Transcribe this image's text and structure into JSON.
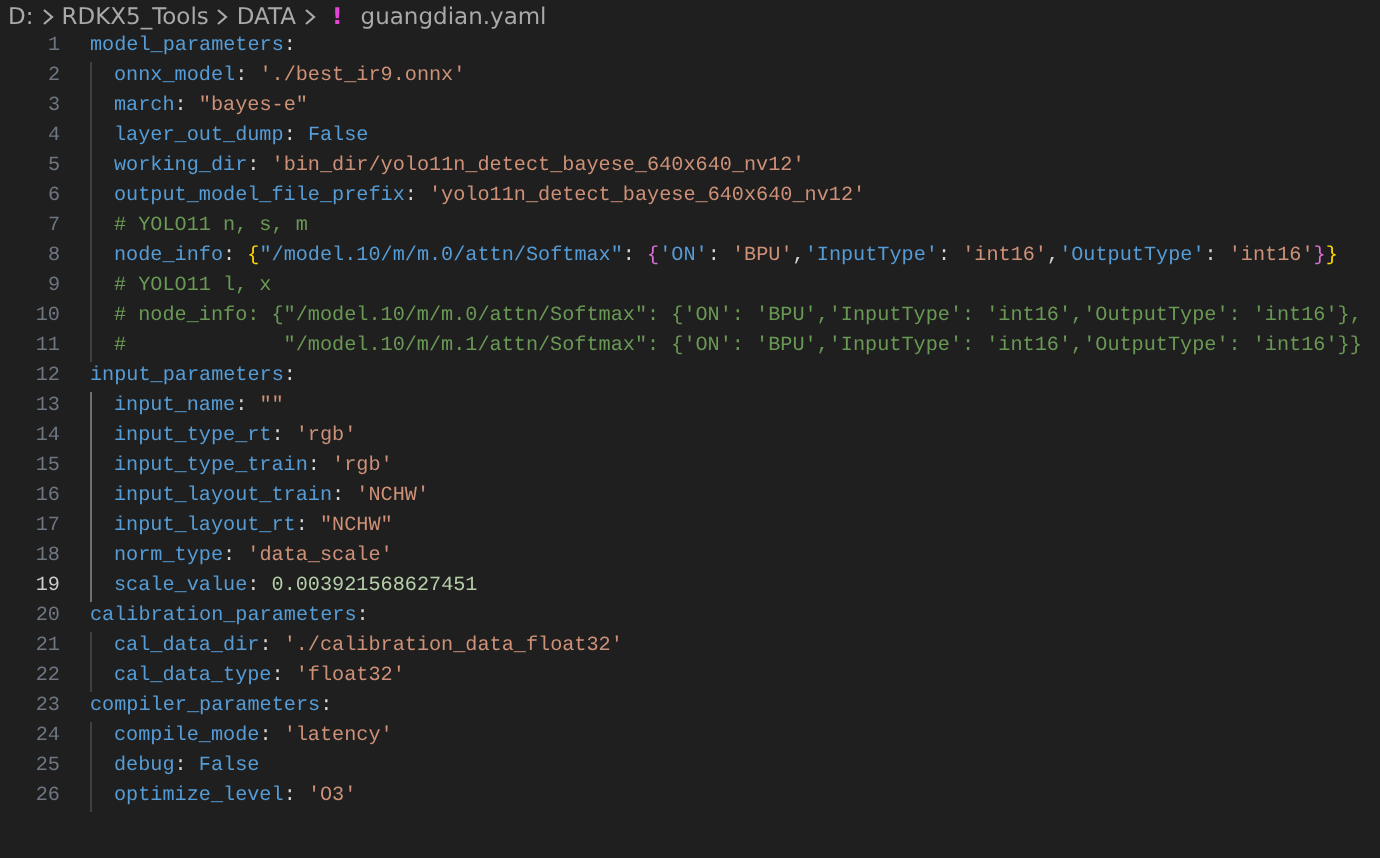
{
  "breadcrumb": {
    "items": [
      {
        "text": "D:",
        "kind": "folder"
      },
      {
        "text": "RDKX5_Tools",
        "kind": "folder"
      },
      {
        "text": "DATA",
        "kind": "folder"
      },
      {
        "text": "guangdian.yaml",
        "kind": "file",
        "icon": "!"
      }
    ]
  },
  "editor": {
    "lines": [
      {
        "number": "1",
        "current": false,
        "tokens": [
          {
            "kind": "key",
            "text": "model_parameters"
          },
          {
            "kind": "punct",
            "text": ":"
          }
        ],
        "children": [
          {
            "number": "2",
            "current": false,
            "tokens": [
              {
                "kind": "key",
                "text": "onnx_model"
              },
              {
                "kind": "punct",
                "text": ": "
              },
              {
                "kind": "string",
                "text": "'./best_ir9.onnx'"
              }
            ]
          },
          {
            "number": "3",
            "current": false,
            "tokens": [
              {
                "kind": "key",
                "text": "march"
              },
              {
                "kind": "punct",
                "text": ": "
              },
              {
                "kind": "string",
                "text": "\"bayes-e\""
              }
            ]
          },
          {
            "number": "4",
            "current": false,
            "tokens": [
              {
                "kind": "key",
                "text": "layer_out_dump"
              },
              {
                "kind": "punct",
                "text": ": "
              },
              {
                "kind": "keyword",
                "text": "False"
              }
            ]
          },
          {
            "number": "5",
            "current": false,
            "tokens": [
              {
                "kind": "key",
                "text": "working_dir"
              },
              {
                "kind": "punct",
                "text": ": "
              },
              {
                "kind": "string",
                "text": "'bin_dir/yolo11n_detect_bayese_640x640_nv12'"
              }
            ]
          },
          {
            "number": "6",
            "current": false,
            "tokens": [
              {
                "kind": "key",
                "text": "output_model_file_prefix"
              },
              {
                "kind": "punct",
                "text": ": "
              },
              {
                "kind": "string",
                "text": "'yolo11n_detect_bayese_640x640_nv12'"
              }
            ]
          },
          {
            "number": "7",
            "current": false,
            "tokens": [
              {
                "kind": "comment",
                "text": "# YOLO11 n, s, m"
              }
            ]
          },
          {
            "number": "8",
            "current": false,
            "tokens": [
              {
                "kind": "key",
                "text": "node_info"
              },
              {
                "kind": "punct",
                "text": ": "
              },
              {
                "kind": "bracket1",
                "text": "{"
              },
              {
                "kind": "key",
                "text": "\"/model.10/m/m.0/attn/Softmax\""
              },
              {
                "kind": "punct",
                "text": ": "
              },
              {
                "kind": "bracket2",
                "text": "{"
              },
              {
                "kind": "key",
                "text": "'ON'"
              },
              {
                "kind": "punct",
                "text": ": "
              },
              {
                "kind": "string",
                "text": "'BPU'"
              },
              {
                "kind": "punct",
                "text": ","
              },
              {
                "kind": "key",
                "text": "'InputType'"
              },
              {
                "kind": "punct",
                "text": ": "
              },
              {
                "kind": "string",
                "text": "'int16'"
              },
              {
                "kind": "punct",
                "text": ","
              },
              {
                "kind": "key",
                "text": "'OutputType'"
              },
              {
                "kind": "punct",
                "text": ": "
              },
              {
                "kind": "string",
                "text": "'int16'"
              },
              {
                "kind": "bracket2",
                "text": "}"
              },
              {
                "kind": "bracket1",
                "text": "}"
              }
            ]
          },
          {
            "number": "9",
            "current": false,
            "tokens": [
              {
                "kind": "comment",
                "text": "# YOLO11 l, x"
              }
            ]
          },
          {
            "number": "10",
            "current": false,
            "tokens": [
              {
                "kind": "comment",
                "text": "# node_info: {\"/model.10/m/m.0/attn/Softmax\": {'ON': 'BPU','InputType': 'int16','OutputType': 'int16'},"
              }
            ]
          },
          {
            "number": "11",
            "current": false,
            "tokens": [
              {
                "kind": "comment",
                "text": "#             \"/model.10/m/m.1/attn/Softmax\": {'ON': 'BPU','InputType': 'int16','OutputType': 'int16'}}"
              }
            ]
          }
        ]
      },
      {
        "number": "12",
        "current": false,
        "tokens": [
          {
            "kind": "key",
            "text": "input_parameters"
          },
          {
            "kind": "punct",
            "text": ":"
          }
        ],
        "children": [
          {
            "number": "13",
            "current": false,
            "tokens": [
              {
                "kind": "key",
                "text": "input_name"
              },
              {
                "kind": "punct",
                "text": ": "
              },
              {
                "kind": "string",
                "text": "\"\""
              }
            ]
          },
          {
            "number": "14",
            "current": false,
            "tokens": [
              {
                "kind": "key",
                "text": "input_type_rt"
              },
              {
                "kind": "punct",
                "text": ": "
              },
              {
                "kind": "string",
                "text": "'rgb'"
              }
            ]
          },
          {
            "number": "15",
            "current": false,
            "tokens": [
              {
                "kind": "key",
                "text": "input_type_train"
              },
              {
                "kind": "punct",
                "text": ": "
              },
              {
                "kind": "string",
                "text": "'rgb'"
              }
            ]
          },
          {
            "number": "16",
            "current": false,
            "tokens": [
              {
                "kind": "key",
                "text": "input_layout_train"
              },
              {
                "kind": "punct",
                "text": ": "
              },
              {
                "kind": "string",
                "text": "'NCHW'"
              }
            ]
          },
          {
            "number": "17",
            "current": false,
            "tokens": [
              {
                "kind": "key",
                "text": "input_layout_rt"
              },
              {
                "kind": "punct",
                "text": ": "
              },
              {
                "kind": "string",
                "text": "\"NCHW\""
              }
            ]
          },
          {
            "number": "18",
            "current": false,
            "tokens": [
              {
                "kind": "key",
                "text": "norm_type"
              },
              {
                "kind": "punct",
                "text": ": "
              },
              {
                "kind": "string",
                "text": "'data_scale'"
              }
            ]
          },
          {
            "number": "19",
            "current": true,
            "tokens": [
              {
                "kind": "key",
                "text": "scale_value"
              },
              {
                "kind": "punct",
                "text": ": "
              },
              {
                "kind": "number",
                "text": "0.003921568627451"
              }
            ]
          }
        ]
      },
      {
        "number": "20",
        "current": false,
        "tokens": [
          {
            "kind": "key",
            "text": "calibration_parameters"
          },
          {
            "kind": "punct",
            "text": ":"
          }
        ],
        "children": [
          {
            "number": "21",
            "current": false,
            "tokens": [
              {
                "kind": "key",
                "text": "cal_data_dir"
              },
              {
                "kind": "punct",
                "text": ": "
              },
              {
                "kind": "string",
                "text": "'./calibration_data_float32'"
              }
            ]
          },
          {
            "number": "22",
            "current": false,
            "tokens": [
              {
                "kind": "key",
                "text": "cal_data_type"
              },
              {
                "kind": "punct",
                "text": ": "
              },
              {
                "kind": "string",
                "text": "'float32'"
              }
            ]
          }
        ]
      },
      {
        "number": "23",
        "current": false,
        "tokens": [
          {
            "kind": "key",
            "text": "compiler_parameters"
          },
          {
            "kind": "punct",
            "text": ":"
          }
        ],
        "children": [
          {
            "number": "24",
            "current": false,
            "tokens": [
              {
                "kind": "key",
                "text": "compile_mode"
              },
              {
                "kind": "punct",
                "text": ": "
              },
              {
                "kind": "string",
                "text": "'latency'"
              }
            ]
          },
          {
            "number": "25",
            "current": false,
            "tokens": [
              {
                "kind": "key",
                "text": "debug"
              },
              {
                "kind": "punct",
                "text": ": "
              },
              {
                "kind": "keyword",
                "text": "False"
              }
            ]
          },
          {
            "number": "26",
            "current": false,
            "tokens": [
              {
                "kind": "key",
                "text": "optimize_level"
              },
              {
                "kind": "punct",
                "text": ": "
              },
              {
                "kind": "string",
                "text": "'O3'"
              }
            ]
          }
        ]
      }
    ]
  }
}
